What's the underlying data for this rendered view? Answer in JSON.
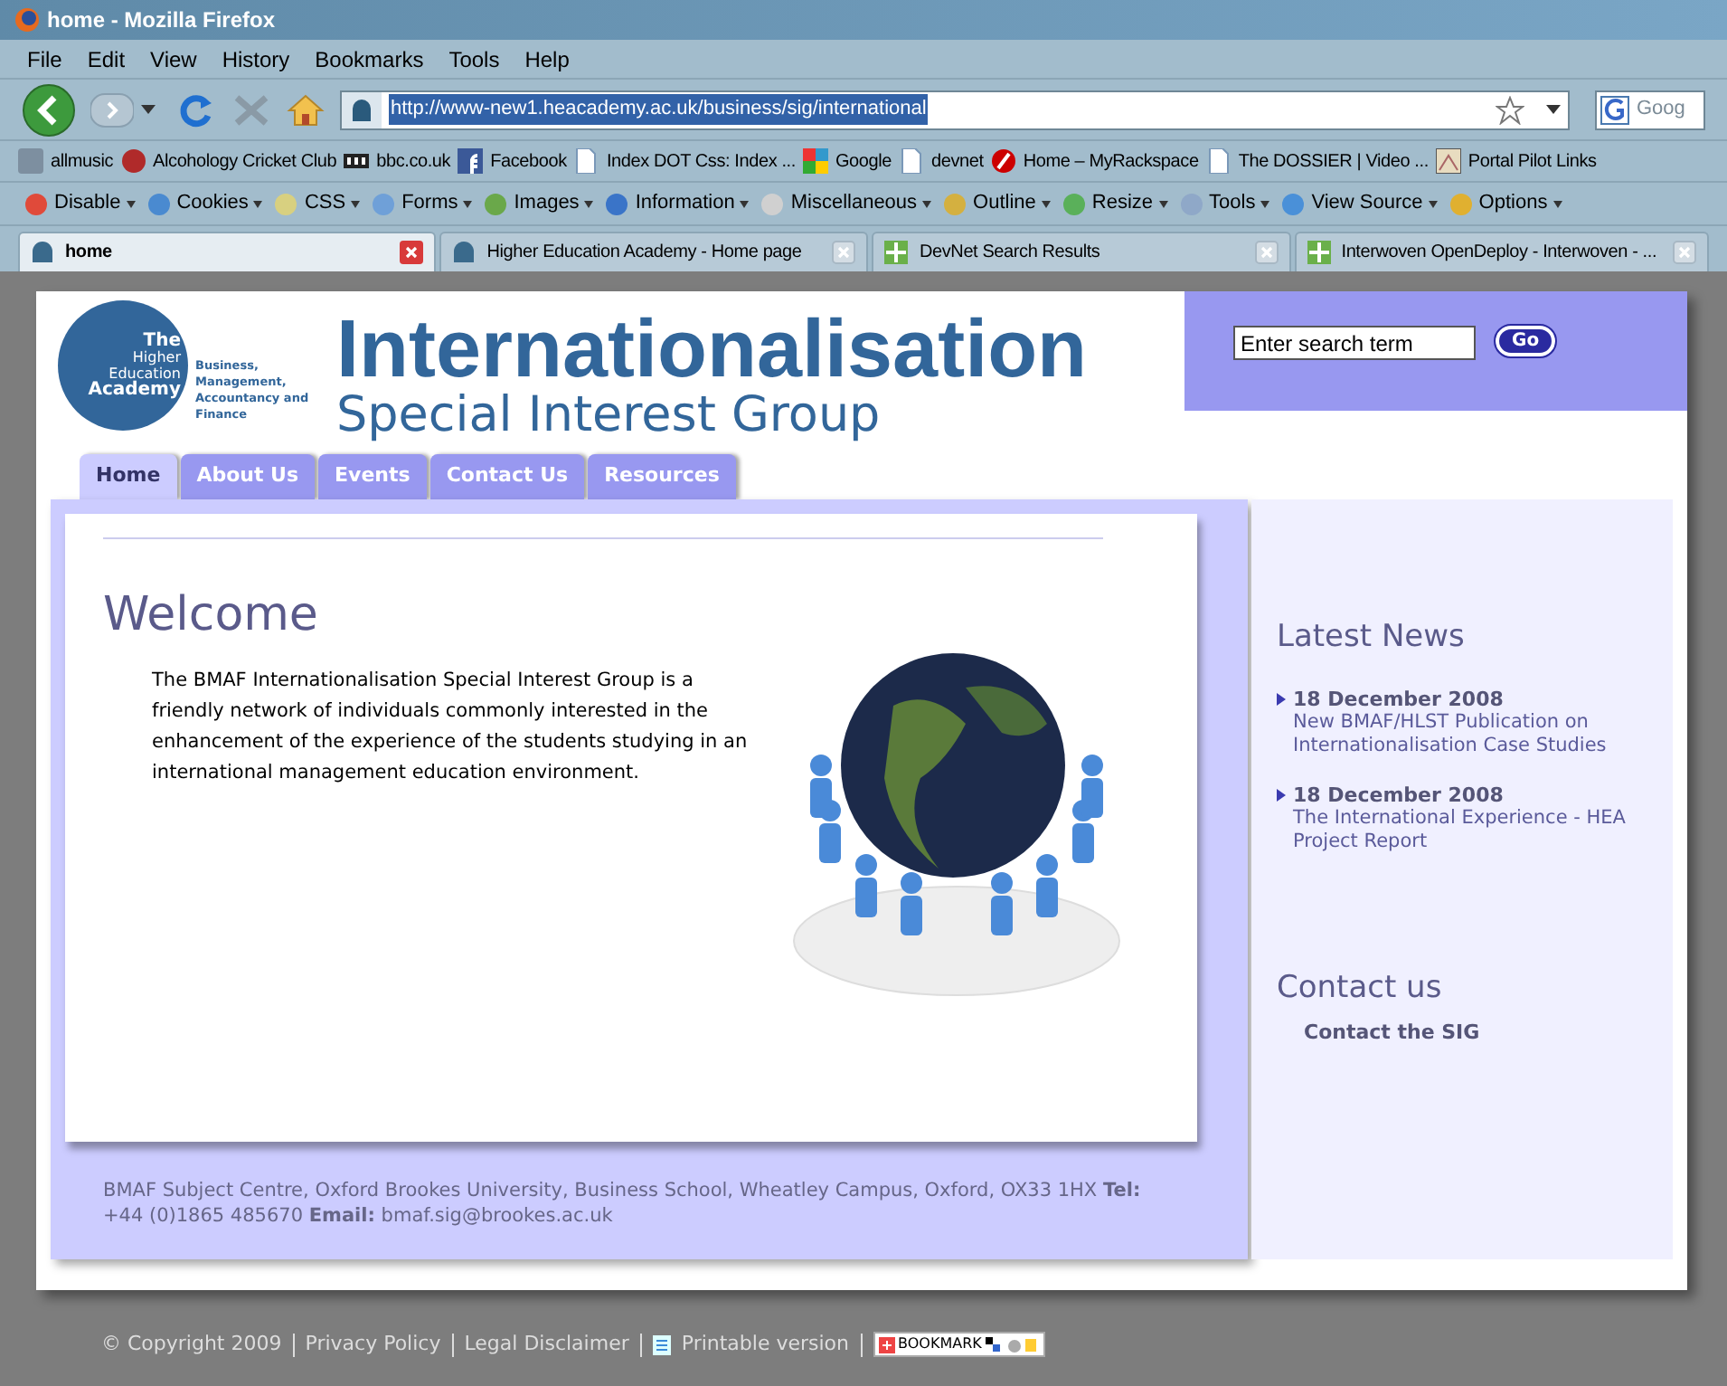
{
  "window": {
    "title": "home - Mozilla Firefox"
  },
  "menu": [
    "File",
    "Edit",
    "View",
    "History",
    "Bookmarks",
    "Tools",
    "Help"
  ],
  "address": {
    "url": "http://www-new1.heacademy.ac.uk/business/sig/international",
    "search_placeholder": "Goog"
  },
  "bookmarks": [
    {
      "label": "allmusic"
    },
    {
      "label": "Alcohology Cricket Club"
    },
    {
      "label": "bbc.co.uk"
    },
    {
      "label": "Facebook"
    },
    {
      "label": "Index DOT Css: Index ..."
    },
    {
      "label": "Google"
    },
    {
      "label": "devnet"
    },
    {
      "label": "Home – MyRackspace"
    },
    {
      "label": "The DOSSIER | Video ..."
    },
    {
      "label": "Portal Pilot Links"
    }
  ],
  "dev_toolbar": [
    {
      "label": "Disable"
    },
    {
      "label": "Cookies"
    },
    {
      "label": "CSS"
    },
    {
      "label": "Forms"
    },
    {
      "label": "Images"
    },
    {
      "label": "Information"
    },
    {
      "label": "Miscellaneous"
    },
    {
      "label": "Outline"
    },
    {
      "label": "Resize"
    },
    {
      "label": "Tools"
    },
    {
      "label": "View Source"
    },
    {
      "label": "Options"
    }
  ],
  "tabs": [
    {
      "label": "home",
      "selected": true
    },
    {
      "label": "Higher Education Academy - Home page",
      "selected": false
    },
    {
      "label": "DevNet Search Results",
      "selected": false
    },
    {
      "label": "Interwoven OpenDeploy - Interwoven - ...",
      "selected": false
    }
  ],
  "page": {
    "logo": {
      "lines": [
        {
          "text": "The",
          "bold": true
        },
        {
          "text": "Higher",
          "bold": false
        },
        {
          "text": "Education",
          "bold": false
        },
        {
          "text": "Academy",
          "bold": true
        }
      ],
      "subject": "Business, Management, Accountancy and Finance"
    },
    "title": "Internationalisation",
    "subtitle": "Special Interest Group",
    "search": {
      "placeholder": "Enter search term",
      "button": "Go"
    },
    "nav": [
      {
        "label": "Home",
        "selected": true
      },
      {
        "label": "About Us",
        "selected": false
      },
      {
        "label": "Events",
        "selected": false
      },
      {
        "label": "Contact Us",
        "selected": false
      },
      {
        "label": "Resources",
        "selected": false
      }
    ],
    "welcome": {
      "heading": "Welcome",
      "text": "The BMAF Internationalisation Special Interest Group is a friendly network of individuals commonly interested in the enhancement of the experience of the students studying in an international management education environment."
    },
    "address": "BMAF Subject Centre, Oxford Brookes University, Business School, Wheatley Campus, Oxford, OX33 1HX **Tel:** +44 (0)1865 485670 **Email:** bmaf.sig@brookes.ac.uk",
    "sidebar": {
      "news_heading": "Latest News",
      "news": [
        {
          "date": "18 December 2008",
          "text": "New BMAF/HLST Publication on Internationalisation Case Studies"
        },
        {
          "date": "18 December 2008",
          "text": "The International Experience - HEA Project Report"
        }
      ],
      "contact_heading": "Contact us",
      "contact_link": "Contact the SIG"
    },
    "footer": {
      "links": [
        "© Copyright 2009",
        "Privacy Policy",
        "Legal Disclaimer",
        "Printable version"
      ],
      "bookmark": "BOOKMARK"
    }
  }
}
